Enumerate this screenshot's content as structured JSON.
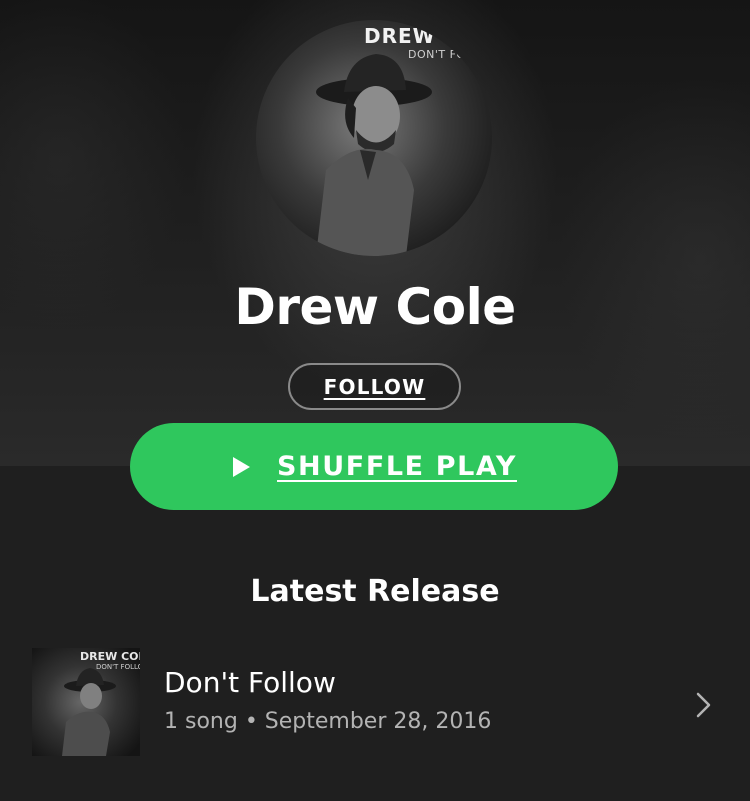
{
  "artist": {
    "name": "Drew Cole",
    "avatar_brand": "DREW COLE",
    "avatar_subtitle": "DON'T FOLLOW"
  },
  "actions": {
    "follow_label": "FOLLOW",
    "shuffle_label": "SHUFFLE PLAY"
  },
  "latest_release": {
    "section_title": "Latest Release",
    "title": "Don't Follow",
    "meta": "1 song • September 28, 2016",
    "art_brand": "DREW COLE",
    "art_subtitle": "DON'T FOLLOW"
  },
  "icons": {
    "play": "play-icon",
    "chevron": "chevron-right-icon"
  },
  "colors": {
    "accent": "#2fc75d",
    "background": "#1f1f1f",
    "secondary_text": "#b3b3b3"
  }
}
